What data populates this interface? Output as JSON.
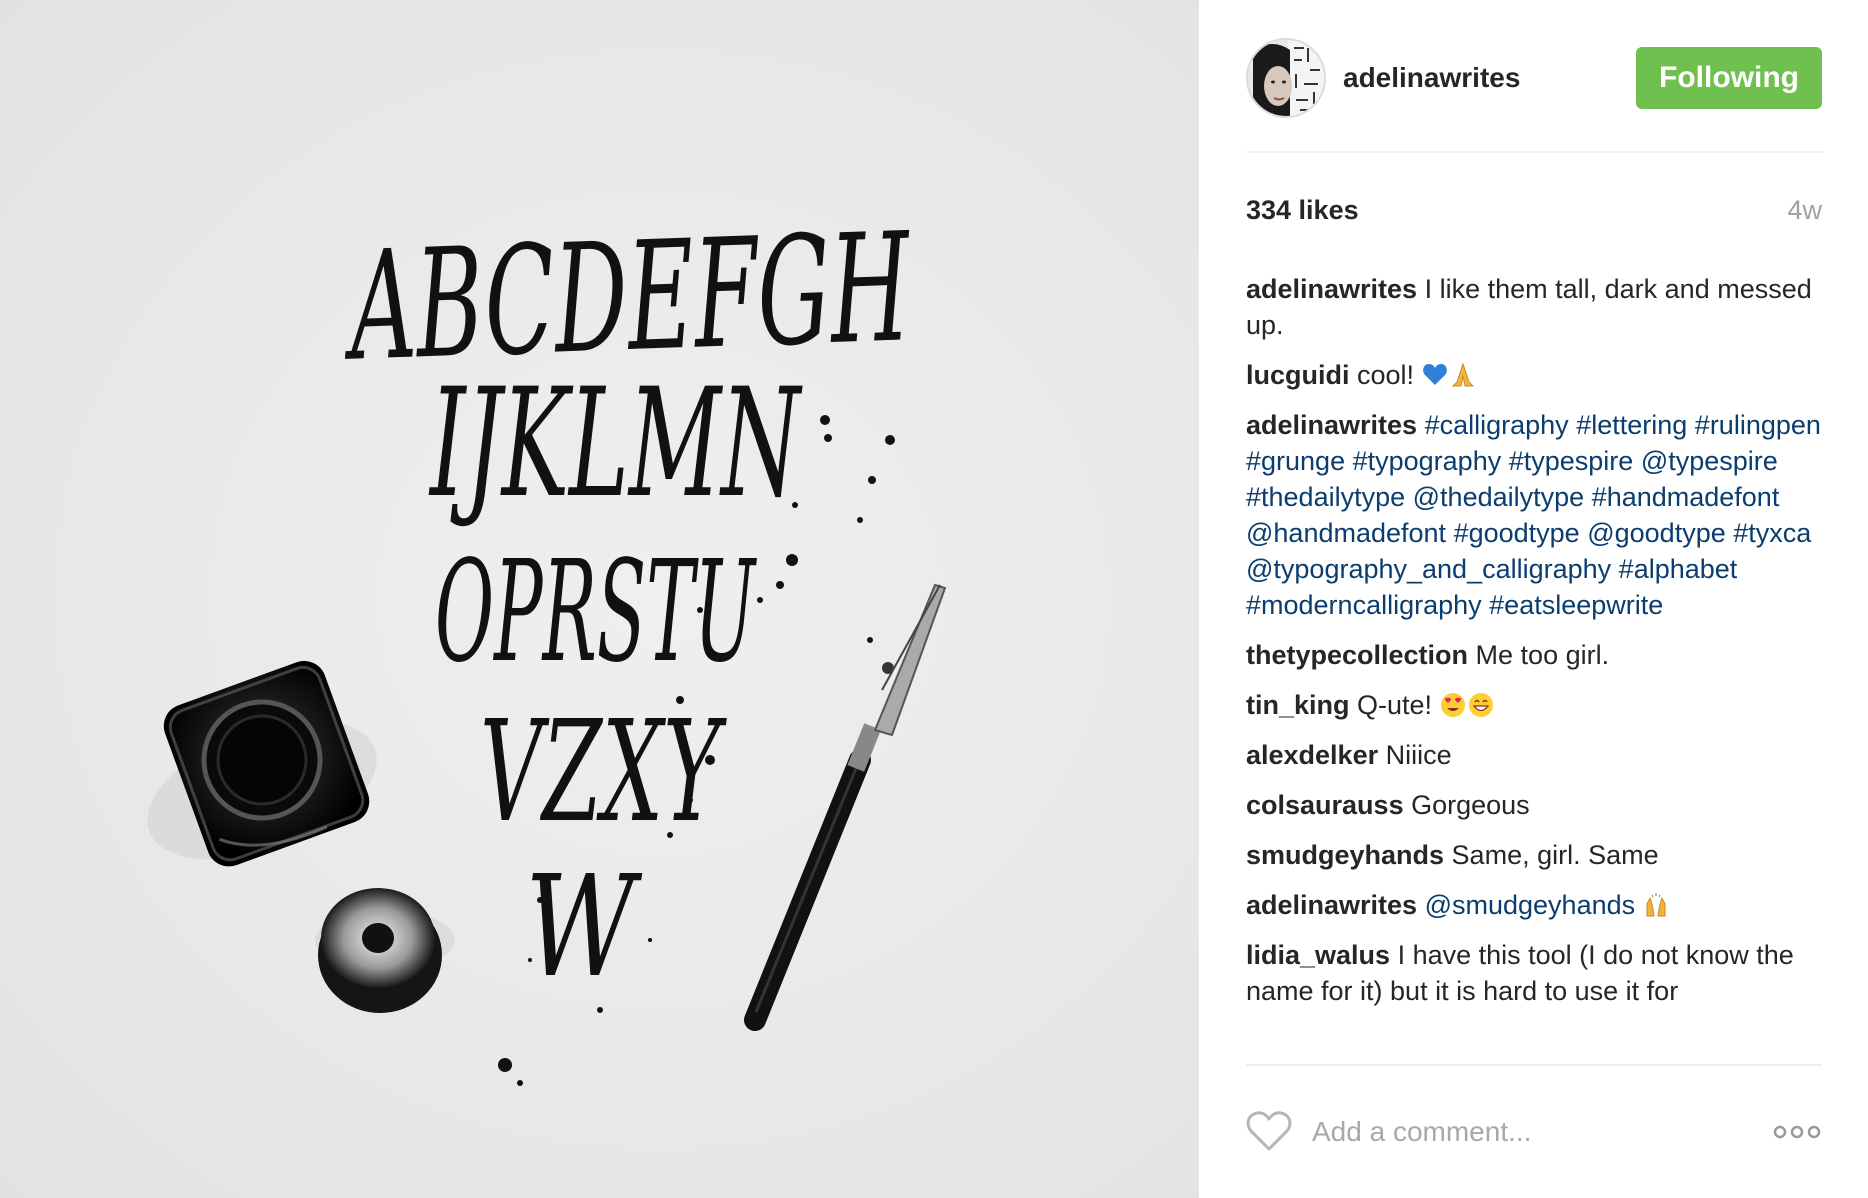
{
  "post": {
    "image": {
      "alt_icon": "calligraphy-alphabet-photo",
      "letters_row1": "ABCDEFGH",
      "letters_row2": "IJKLMN",
      "letters_row3": "OPRSTU",
      "letters_row4": "VZXY",
      "letters_row5": "W"
    },
    "header": {
      "username": "adelinawrites",
      "follow_label": "Following",
      "follow_color": "#70c050"
    },
    "stats": {
      "likes": "334 likes",
      "time_ago": "4w"
    },
    "comments": [
      {
        "user": "adelinawrites",
        "parts": [
          {
            "text": " I like them tall, dark and messed up.",
            "link": false
          }
        ]
      },
      {
        "user": "lucguidi",
        "parts": [
          {
            "text": " cool! ",
            "link": false
          }
        ],
        "emoji": [
          "blue-heart-icon",
          "folded-hands-icon"
        ]
      },
      {
        "user": "adelinawrites",
        "parts": [
          {
            "text": " ",
            "link": false
          },
          {
            "text": "#calligraphy",
            "link": true
          },
          {
            "text": " ",
            "link": false
          },
          {
            "text": "#lettering",
            "link": true
          },
          {
            "text": " ",
            "link": false
          },
          {
            "text": "#rulingpen",
            "link": true
          },
          {
            "text": " ",
            "link": false
          },
          {
            "text": "#grunge",
            "link": true
          },
          {
            "text": " ",
            "link": false
          },
          {
            "text": "#typography",
            "link": true
          },
          {
            "text": " ",
            "link": false
          },
          {
            "text": "#typespire",
            "link": true
          },
          {
            "text": " ",
            "link": false
          },
          {
            "text": "@typespire",
            "link": true
          },
          {
            "text": " ",
            "link": false
          },
          {
            "text": "#thedailytype",
            "link": true
          },
          {
            "text": " ",
            "link": false
          },
          {
            "text": "@thedailytype",
            "link": true
          },
          {
            "text": " ",
            "link": false
          },
          {
            "text": "#handmadefont",
            "link": true
          },
          {
            "text": " ",
            "link": false
          },
          {
            "text": "@handmadefont",
            "link": true
          },
          {
            "text": " ",
            "link": false
          },
          {
            "text": "#goodtype",
            "link": true
          },
          {
            "text": " ",
            "link": false
          },
          {
            "text": "@goodtype",
            "link": true
          },
          {
            "text": " ",
            "link": false
          },
          {
            "text": "#tyxca",
            "link": true
          },
          {
            "text": " ",
            "link": false
          },
          {
            "text": "@typography_and_calligraphy",
            "link": true
          },
          {
            "text": " ",
            "link": false
          },
          {
            "text": "#alphabet",
            "link": true
          },
          {
            "text": " ",
            "link": false
          },
          {
            "text": "#moderncalligraphy",
            "link": true
          },
          {
            "text": " ",
            "link": false
          },
          {
            "text": "#eatsleepwrite",
            "link": true
          }
        ]
      },
      {
        "user": "thetypecollection",
        "parts": [
          {
            "text": " Me too girl.",
            "link": false
          }
        ]
      },
      {
        "user": "tin_king",
        "parts": [
          {
            "text": " Q-ute! ",
            "link": false
          }
        ],
        "emoji": [
          "heart-eyes-icon",
          "grinning-face-icon"
        ]
      },
      {
        "user": "alexdelker",
        "parts": [
          {
            "text": " Niiice",
            "link": false
          }
        ]
      },
      {
        "user": "colsaurauss",
        "parts": [
          {
            "text": " Gorgeous",
            "link": false
          }
        ]
      },
      {
        "user": "smudgeyhands",
        "parts": [
          {
            "text": " Same, girl. Same",
            "link": false
          }
        ]
      },
      {
        "user": "adelinawrites",
        "parts": [
          {
            "text": " ",
            "link": false
          },
          {
            "text": "@smudgeyhands",
            "link": true
          },
          {
            "text": " ",
            "link": false
          }
        ],
        "emoji": [
          "raising-hands-icon"
        ]
      },
      {
        "user": "lidia_walus",
        "parts": [
          {
            "text": " I have this tool (I do not know the name for it) but it is hard to use it for",
            "link": false
          }
        ]
      }
    ],
    "footer": {
      "like_icon": "heart-outline-icon",
      "comment_placeholder": "Add a comment...",
      "more_icon": "more-options-icon"
    },
    "colors": {
      "link": "#0b3d6e",
      "text": "#262626",
      "muted": "#a0a0a0"
    }
  }
}
